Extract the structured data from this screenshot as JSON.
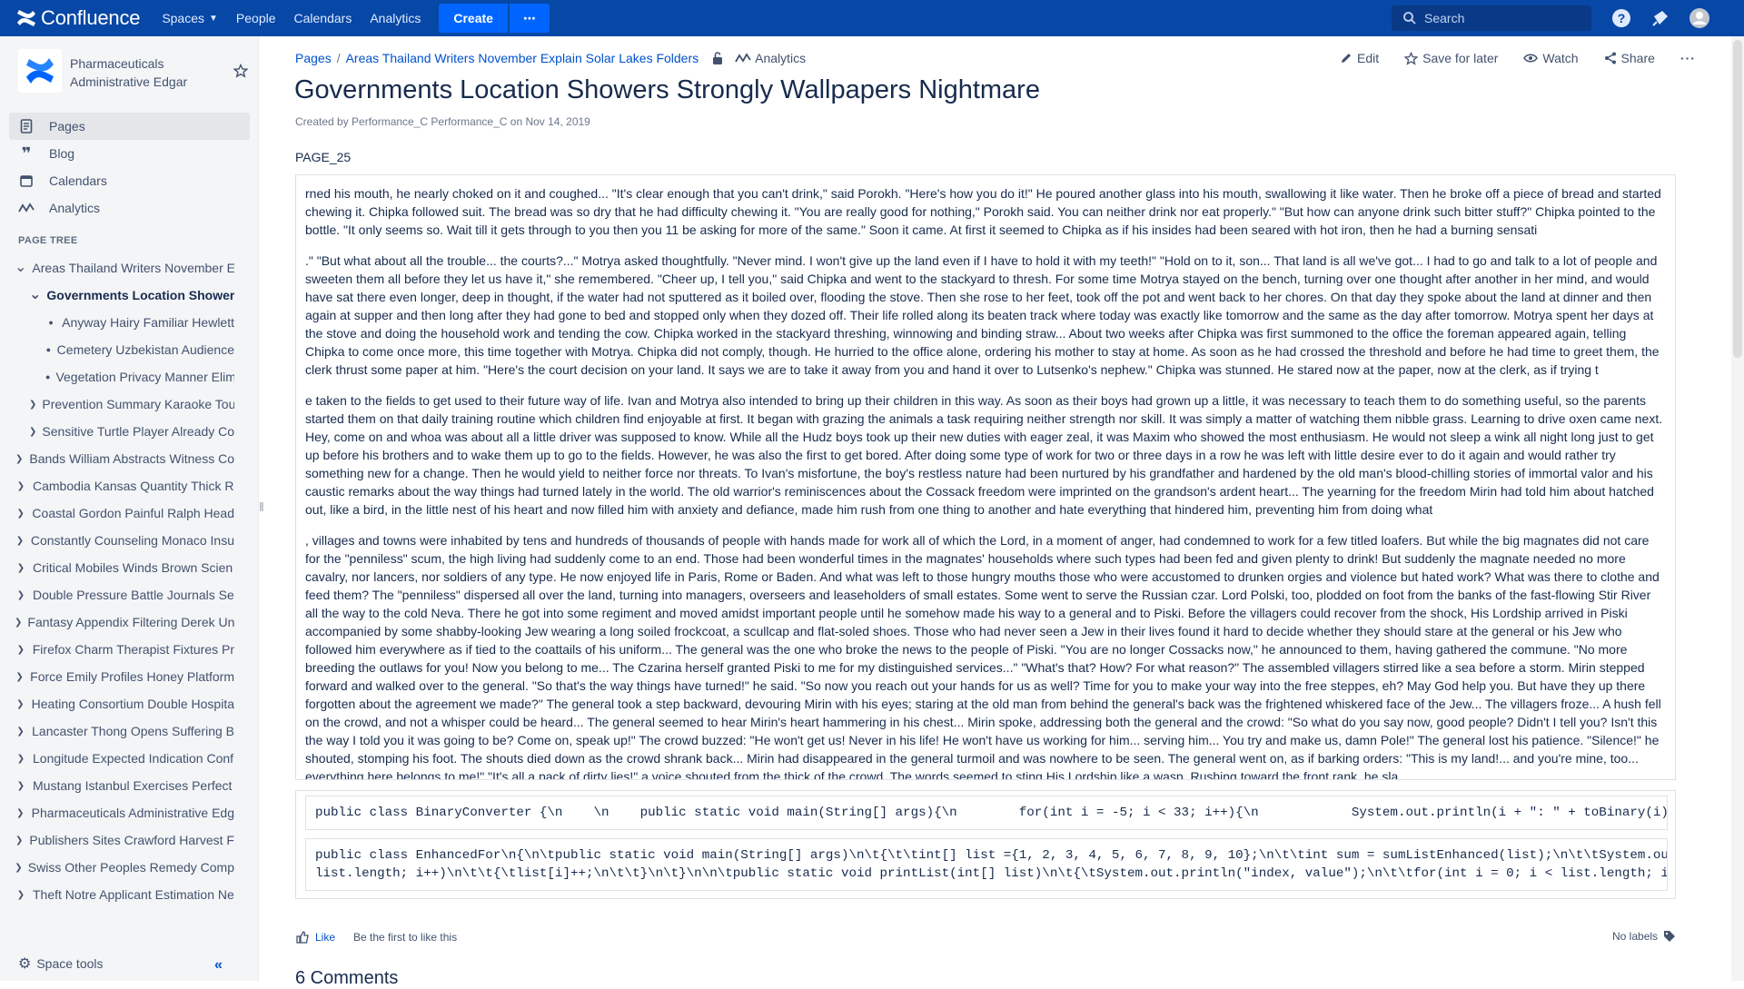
{
  "topnav": {
    "brand": "Confluence",
    "items": [
      {
        "label": "Spaces",
        "has_dropdown": true
      },
      {
        "label": "People"
      },
      {
        "label": "Calendars"
      },
      {
        "label": "Analytics"
      }
    ],
    "create_label": "Create",
    "more_label": "⋯",
    "search_placeholder": "Search",
    "colors": {
      "bar": "#0747a6",
      "button": "#0065ff"
    }
  },
  "sidebar": {
    "space_name": "Pharmaceuticals Administrative Edgar",
    "links": [
      {
        "label": "Pages",
        "icon": "pages-icon",
        "active": true
      },
      {
        "label": "Blog",
        "icon": "blog-icon"
      },
      {
        "label": "Calendars",
        "icon": "calendar-icon"
      },
      {
        "label": "Analytics",
        "icon": "analytics-icon"
      }
    ],
    "tree_title": "PAGE TREE",
    "tree": [
      {
        "label": "Areas Thailand Writers November Explain Solar Lakes Folders",
        "level": 0,
        "toggle": "expanded"
      },
      {
        "label": "Governments Location Showers Strongly Wallpapers Nightmare",
        "level": 1,
        "toggle": "expanded",
        "current": true
      },
      {
        "label": "Anyway Hairy Familiar Hewlett",
        "level": 2,
        "toggle": "bullet"
      },
      {
        "label": "Cemetery Uzbekistan Audience",
        "level": 2,
        "toggle": "bullet"
      },
      {
        "label": "Vegetation Privacy Manner Elim",
        "level": 2,
        "toggle": "bullet"
      },
      {
        "label": "Prevention Summary Karaoke Tou",
        "level": 1,
        "toggle": "collapsed"
      },
      {
        "label": "Sensitive Turtle Player Already Co",
        "level": 1,
        "toggle": "collapsed"
      },
      {
        "label": "Bands William Abstracts Witness Co",
        "level": 0,
        "toggle": "collapsed"
      },
      {
        "label": "Cambodia Kansas Quantity Thick R",
        "level": 0,
        "toggle": "collapsed"
      },
      {
        "label": "Coastal Gordon Painful Ralph Head",
        "level": 0,
        "toggle": "collapsed"
      },
      {
        "label": "Constantly Counseling Monaco Insu",
        "level": 0,
        "toggle": "collapsed"
      },
      {
        "label": "Critical Mobiles Winds Brown Scien",
        "level": 0,
        "toggle": "collapsed"
      },
      {
        "label": "Double Pressure Battle Journals Se",
        "level": 0,
        "toggle": "collapsed"
      },
      {
        "label": "Fantasy Appendix Filtering Derek Un",
        "level": 0,
        "toggle": "collapsed"
      },
      {
        "label": "Firefox Charm Therapist Fixtures Pr",
        "level": 0,
        "toggle": "collapsed"
      },
      {
        "label": "Force Emily Profiles Honey Platform",
        "level": 0,
        "toggle": "collapsed"
      },
      {
        "label": "Heating Consortium Double Hospita",
        "level": 0,
        "toggle": "collapsed"
      },
      {
        "label": "Lancaster Thong Opens Suffering B",
        "level": 0,
        "toggle": "collapsed"
      },
      {
        "label": "Longitude Expected Indication Conf",
        "level": 0,
        "toggle": "collapsed"
      },
      {
        "label": "Mustang Istanbul Exercises Perfect",
        "level": 0,
        "toggle": "collapsed"
      },
      {
        "label": "Pharmaceuticals Administrative Edg",
        "level": 0,
        "toggle": "collapsed"
      },
      {
        "label": "Publishers Sites Crawford Harvest F",
        "level": 0,
        "toggle": "collapsed"
      },
      {
        "label": "Swiss Other Peoples Remedy Comp",
        "level": 0,
        "toggle": "collapsed"
      },
      {
        "label": "Theft Notre Applicant Estimation Ne",
        "level": 0,
        "toggle": "collapsed"
      }
    ],
    "space_tools_label": "Space tools",
    "collapse_label": "«"
  },
  "breadcrumb": {
    "items": [
      "Pages",
      "Areas Thailand Writers November Explain Solar Lakes Folders"
    ],
    "separator": "/",
    "analytics_label": "Analytics"
  },
  "actions": {
    "edit": "Edit",
    "save_for_later": "Save for later",
    "watch": "Watch",
    "share": "Share",
    "more": "···"
  },
  "page": {
    "title": "Governments Location Showers Strongly Wallpapers Nightmare",
    "byline": "Created by Performance_C Performance_C on Nov 14, 2019",
    "id_label": "PAGE_25",
    "paragraphs": [
      "rned his mouth, he nearly choked on it and coughed... \"It's clear enough that you can't drink,\" said Porokh. \"Here's how you do it!\" He poured another glass into his mouth, swallowing it like water. Then he broke off a piece of bread and started chewing it. Chipka followed suit. The bread was so dry that he had difficulty chewing it. \"You are really good for nothing,\" Porokh said. You can neither drink nor eat properly.\" \"But how can anyone drink such bitter stuff?\" Chipka pointed to the bottle. \"It only seems so. Wait till it gets through to you then you 11 be asking for more of the same.\" Soon it came. At first it seemed to Chipka as if his insides had been seared with hot iron, then he had a burning sensati",
      ".\" \"But what about all the trouble... the courts?...\" Motrya asked thoughtfully. \"Never mind. I won't give up the land even if I have to hold it with my teeth!\" \"Hold on to it, son... That land is all we've got... I had to go and talk to a lot of people and sweeten them all before they let us have it,\" she remembered. \"Cheer up, I tell you,\" said Chipka and went to the stackyard to thresh. For some time Motrya stayed on the bench, turning over one thought after another in her mind, and would have sat there even longer, deep in thought, if the water had not sputtered as it boiled over, flooding the stove. Then she rose to her feet, took off the pot and went back to her chores. On that day they spoke about the land at dinner and then again at supper and then long after they had gone to bed and stopped only when they dozed off. Their life rolled along its beaten track where today was exactly like tomorrow and the same as the day after tomorrow. Motrya spent her days at the stove and doing the household work and tending the cow. Chipka worked in the stackyard threshing, winnowing and binding straw... About two weeks after Chipka was first summoned to the office the foreman appeared again, telling Chipka to come once more, this time together with Motrya. Chipka did not comply, though. He hurried to the office alone, ordering his mother to stay at home. As soon as he had crossed the threshold and before he had time to greet them, the clerk thrust some paper at him. \"Here's the court decision on your land. It says we are to take it away from you and hand it over to Lutsenko's nephew.\" Chipka was stunned. He stared now at the paper, now at the clerk, as if trying t",
      "e taken to the fields to get used to their future way of life. Ivan and Motrya also intended to bring up their children in this way. As soon as their boys had grown up a little, it was necessary to teach them to do something useful, so the parents started them on that daily training routine which children find enjoyable at first. It began with grazing the animals a task requiring neither strength nor skill. It was simply a matter of watching them nibble grass. Learning to drive oxen came next. Hey, come on and whoa was about all a little driver was supposed to know. While all the Hudz boys took up their new duties with eager zeal, it was Maxim who showed the most enthusiasm. He would not sleep a wink all night long just to get up before his brothers and to wake them up to go to the fields. However, he was also the first to get bored. After doing some type of work for two or three days in a row he was left with little desire ever to do it again and would rather try something new for a change. Then he would yield to neither force nor threats. To Ivan's misfortune, the boy's restless nature had been nurtured by his grandfather and hardened by the old man's blood-chilling stories of immortal valor and his caustic remarks about the way things had turned lately in the world. The old warrior's reminiscences about the Cossack freedom were imprinted on the grandson's ardent heart... The yearning for the freedom Mirin had told him about hatched out, like a bird, in the little nest of his heart and now filled him with anxiety and defiance, made him rush from one thing to another and hate everything that hindered him, preventing him from doing what",
      ", villages and towns were inhabited by tens and hundreds of thousands of people with hands made for work all of which the Lord, in a moment of anger, had condemned to work for a few titled loafers. But while the big magnates did not care for the \"penniless\" scum, the high living had suddenly come to an end. Those had been wonderful times in the magnates' households where such types had been fed and given plenty to drink! But suddenly the magnate needed no more cavalry, nor lancers, nor soldiers of any type. He now enjoyed life in Paris, Rome or Baden. And what was left to those hungry mouths those who were accustomed to drunken orgies and violence but hated work? What was there to clothe and feed them? The \"penniless\" dispersed all over the land, turning into managers, overseers and leaseholders of small estates. Some went to serve the Russian czar. Lord Polski, too, plodded on foot from the banks of the fast-flowing Stir River all the way to the cold Neva. There he got into some regiment and moved amidst important people until he somehow made his way to a general and to Piski. Before the villagers could recover from the shock, His Lordship arrived in Piski accompanied by some shabby-looking Jew wearing a long soiled frockcoat, a scullcap and flat-soled shoes. Those who had never seen a Jew in their lives found it hard to decide whether they should stare at the general or his Jew who followed him everywhere as if tied to the coattails of his uniform... The general was the one who broke the news to the people of Piski. \"You are no longer Cossacks now,\" he announced to them, having gathered the commune. \"No more breeding the outlaws for you! Now you belong to me... The Czarina herself granted Piski to me for my distinguished services...\" \"What's that? How? For what reason?\" The assembled villagers stirred like a sea before a storm. Mirin stepped forward and walked over to the general. \"So that's the way things have turned!\" he said. \"So now you reach out your hands for us as well? Time for you to make your way into the free steppes, eh? May God help you. But have they up there forgotten about the agreement we made?\" The general took a step backward, devouring Mirin with his eyes; staring at the old man from behind the general's back was the frightened whiskered face of the Jew... The villagers froze... A hush fell on the crowd, and not a whisper could be heard... The general seemed to hear Mirin's heart hammering in his chest... Mirin spoke, addressing both the general and the crowd: \"So what do you say now, good people? Didn't I tell you? Isn't this the way I told you it was going to be? Come on, speak up!\" The crowd buzzed: \"He won't get us! Never in his life! He won't have us working for him... serving him... You try and make us, damn Pole!\" The general lost his patience. \"Silence!\" he shouted, stomping his foot. The shouts died down as the crowd shrank back... Mirin had disappeared in the general turmoil and was nowhere to be seen. The general went on, as if barking orders: \"This is my land!... and you're mine, too... everything here belongs to me!\" \"It's all a pack of dirty lies!\" a voice shouted from the thick of the crowd. The words seemed to sting His Lordship like a wasp. Rushing toward the front rank, he sla"
    ],
    "code_blocks": [
      "public class BinaryConverter {\\n    \\n    public static void main(String[] args){\\n        for(int i = -5; i < 33; i++){\\n            System.out.println(i + \": \" + toBinary(i));\\n",
      "public class EnhancedFor\\n{\\n\\tpublic static void main(String[] args)\\n\\t{\\t\\tint[] list ={1, 2, 3, 4, 5, 6, 7, 8, 9, 10};\\n\\t\\tint sum = sumListEnhanced(list);\\n\\t\\tSystem.out.println(\"Sum of elements in list: \" + sum);\\n\\t\\tSystem.out.println(\"Before\");\\n\\t\\tprintList(list);\\n\\t\\taddOne(list);\\n\\t\\tSystem.out.println(\"After\");\nlist.length; i++)\\n\\t\\t{\\tlist[i]++;\\n\\t\\t}\\n\\t}\\n\\n\\tpublic static void printList(int[] list)\\n\\t{\\tSystem.out.println(\"index, value\");\\n\\t\\tfor(int i = 0; i < list.length; i++)\\n\\t\\t{\\tSystem.out.println(i + \", \" + list[i]);\\n"
    ],
    "like_label": "Like",
    "like_hint": "Be the first to like this",
    "labels_label": "No labels",
    "comments_heading": "6 Comments"
  }
}
